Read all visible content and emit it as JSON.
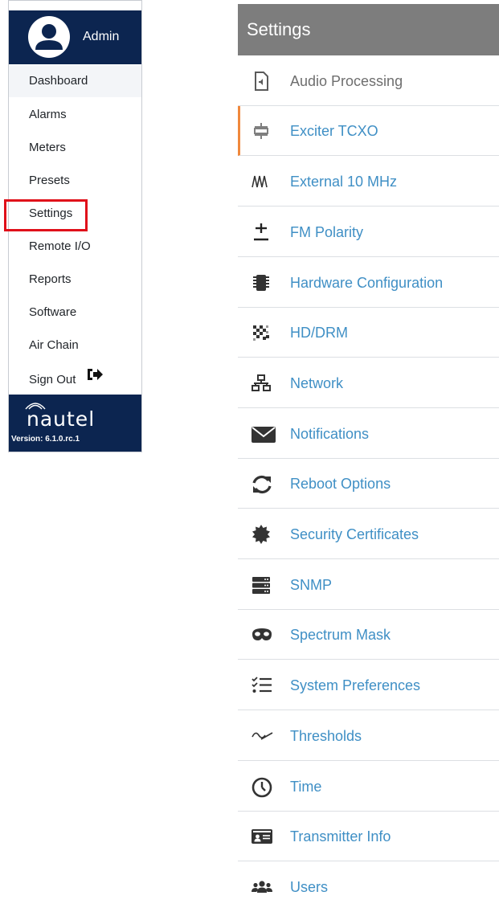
{
  "sidebar": {
    "user": {
      "name": "Admin",
      "icon": "user-avatar-icon"
    },
    "items": [
      {
        "label": "Dashboard"
      },
      {
        "label": "Alarms"
      },
      {
        "label": "Meters"
      },
      {
        "label": "Presets"
      },
      {
        "label": "Settings"
      },
      {
        "label": "Remote I/O"
      },
      {
        "label": "Reports"
      },
      {
        "label": "Software"
      },
      {
        "label": "Air Chain"
      },
      {
        "label": "Sign Out",
        "icon": "sign-out-icon"
      }
    ],
    "footer": {
      "brand": "nautel",
      "version": "Version: 6.1.0.rc.1"
    }
  },
  "settings": {
    "title": "Settings",
    "items": [
      {
        "label": "Audio Processing",
        "icon": "audio-file-icon"
      },
      {
        "label": "Exciter TCXO",
        "icon": "crystal-oscillator-icon"
      },
      {
        "label": "External 10 MHz",
        "icon": "waveform-icon"
      },
      {
        "label": "FM Polarity",
        "icon": "plus-minus-icon"
      },
      {
        "label": "Hardware Configuration",
        "icon": "chip-icon"
      },
      {
        "label": "HD/DRM",
        "icon": "digital-signal-icon"
      },
      {
        "label": "Network",
        "icon": "network-icon"
      },
      {
        "label": "Notifications",
        "icon": "envelope-icon"
      },
      {
        "label": "Reboot Options",
        "icon": "refresh-icon"
      },
      {
        "label": "Security Certificates",
        "icon": "certificate-icon"
      },
      {
        "label": "SNMP",
        "icon": "server-icon"
      },
      {
        "label": "Spectrum Mask",
        "icon": "mask-icon"
      },
      {
        "label": "System Preferences",
        "icon": "checklist-icon"
      },
      {
        "label": "Thresholds",
        "icon": "threshold-wave-icon"
      },
      {
        "label": "Time",
        "icon": "clock-icon"
      },
      {
        "label": "Transmitter Info",
        "icon": "id-card-icon"
      },
      {
        "label": "Users",
        "icon": "users-icon"
      }
    ]
  },
  "colors": {
    "sidebar_navy": "#0c2550",
    "settings_header_gray": "#7d7d7d",
    "link_blue": "#3f8fc5",
    "selected_accent_orange": "#f0883c",
    "highlight_red": "#e0101a"
  }
}
